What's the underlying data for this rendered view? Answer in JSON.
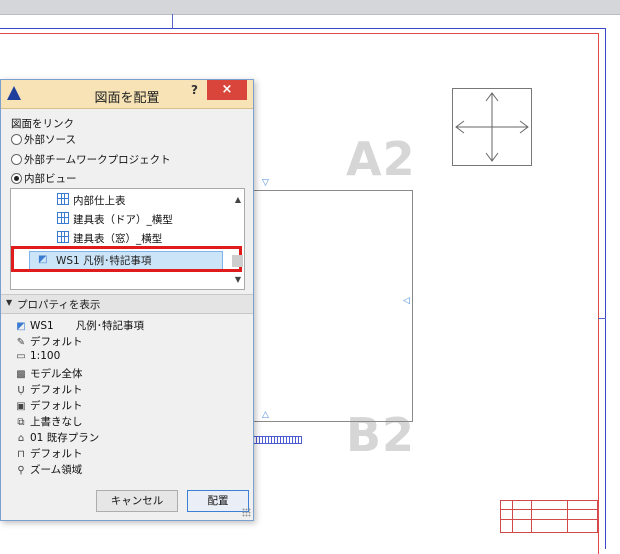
{
  "drawing": {
    "watermark_top": "A2",
    "watermark_bottom": "B2"
  },
  "dialog": {
    "title": "図面を配置",
    "help": "?",
    "close": "×",
    "link_label": "図面をリンク",
    "source_options": [
      {
        "label": "外部ソース",
        "selected": false
      },
      {
        "label": "外部チームワークプロジェクト",
        "selected": false
      },
      {
        "label": "内部ビュー",
        "selected": true
      }
    ],
    "view_list": [
      "内部仕上表",
      "建具表（ドア）_横型",
      "建具表（窓）_横型"
    ],
    "selected_view": "WS1 凡例･特記事項",
    "properties_toggle": "プロパティを表示",
    "properties": {
      "view_id": "WS1",
      "view_name": "凡例･特記事項",
      "items": [
        {
          "icon": "pen-set-icon",
          "label": "デフォルト"
        },
        {
          "icon": "scale-icon",
          "label": "1:100"
        },
        {
          "icon": "model-view-icon",
          "label": "モデル全体"
        },
        {
          "icon": "structure-icon",
          "label": "デフォルト"
        },
        {
          "icon": "display-icon",
          "label": "デフォルト"
        },
        {
          "icon": "override-icon",
          "label": "上書きなし"
        },
        {
          "icon": "renovation-icon",
          "label": "01 既存プラン"
        },
        {
          "icon": "dimension-icon",
          "label": "デフォルト"
        },
        {
          "icon": "zoom-icon",
          "label": "ズーム領域"
        }
      ]
    },
    "cancel_label": "キャンセル",
    "place_label": "配置"
  }
}
